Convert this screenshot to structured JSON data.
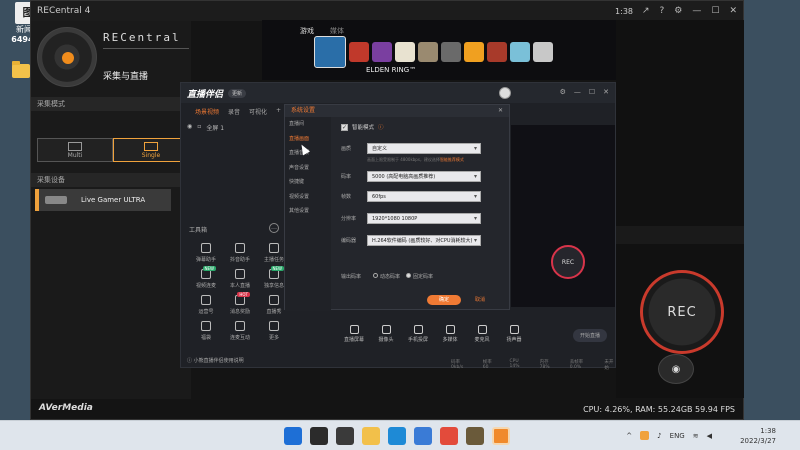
{
  "desktop": {
    "icon_label": "新闻号",
    "icon_number": "649457"
  },
  "recentral": {
    "title": "RECentral 4",
    "controls": [
      "↗",
      "?",
      "⚙",
      "—",
      "☐",
      "✕"
    ],
    "brand": "RECentral",
    "subtitle": "采集与直播",
    "mode_label": "采集模式",
    "modes": [
      {
        "label": "Multi"
      },
      {
        "label": "Single",
        "selected": true
      }
    ],
    "device_label": "采集设备",
    "device_name": "Live Gamer ULTRA",
    "vendor": "AVerMedia",
    "stats": "CPU: 4.26%, RAM: 55.24GB  59.94 FPS",
    "rec_label": "REC",
    "timer": "1:38"
  },
  "game": {
    "tabs": [
      "游戏",
      "媒体"
    ],
    "selected_game": "ELDEN RING™",
    "tile_colors": [
      "#2a6ea8",
      "#c0392b",
      "#7a3fa0",
      "#e8e2d0",
      "#9a8a70",
      "#6a6a6a",
      "#f0a020",
      "#a83a2a",
      "#7ac0d8",
      "#c8c8c8"
    ]
  },
  "streamer": {
    "logo": "直播伴侣",
    "badge": "更新",
    "window_controls": [
      "⚙",
      "—",
      "☐",
      "✕"
    ],
    "tabs": [
      {
        "label": "场景视频",
        "active": true
      },
      {
        "label": "录音"
      },
      {
        "label": "可视化"
      },
      {
        "label": "+"
      }
    ],
    "scene_item": "全屏 1",
    "tools_heading": "工具箱",
    "tools": [
      "弹幕助手",
      "抖音助手",
      "主播任务",
      "视频连麦",
      "本人直播",
      "独享信息",
      "运营号",
      "消息奖励",
      "直播秀",
      "福袋",
      "连麦互动",
      "更多"
    ],
    "tool_tags": {
      "视频连麦": "NEW",
      "独享信息": "NEW",
      "消息奖励": "HOT"
    },
    "footer": "小熊直播伴侣使用说明",
    "bottom_tools": [
      "直播屏幕",
      "摄像头",
      "手机投屏",
      "多媒体",
      "麦克风",
      "扬声器"
    ],
    "start_live": "开始直播",
    "stats_row": [
      "码率 0kb/s",
      "帧率 60",
      "CPU 14%",
      "内存 78%",
      "丢帧率 0.0%",
      "未开始"
    ]
  },
  "settings": {
    "header": "系统设置",
    "menu": [
      "直播间",
      "直播画面",
      "直播音频",
      "声音设置",
      "快捷键",
      "视频设置",
      "其他设置"
    ],
    "active_menu": 1,
    "smart_mode_label": "智能模式",
    "fields": [
      {
        "label": "画质",
        "value": "自定义"
      },
      {
        "label": "码率",
        "value": "5000 (高配电脑高画质推荐)"
      },
      {
        "label": "帧数",
        "value": "60fps"
      },
      {
        "label": "分辨率",
        "value": "1920*1080 1080P"
      },
      {
        "label": "编码器",
        "value": "H.264软件编码 (画质较好、对CPU消耗较大)"
      }
    ],
    "hint": "画面上限受限制于  4800kbps，建议选择",
    "hint_link": "智能推荐模式",
    "output_label": "输出码率",
    "output_options": [
      {
        "label": "动态码率",
        "on": false
      },
      {
        "label": "固定码率",
        "on": true
      }
    ],
    "ok": "确定",
    "cancel": "取消"
  },
  "taskbar": {
    "icons": [
      "windows-icon",
      "search-icon",
      "taskview-icon",
      "explorer-icon",
      "edge-icon",
      "store-icon",
      "chrome-icon",
      "game-icon",
      "app-icon"
    ],
    "tray": [
      "^",
      "ENG"
    ],
    "time": "1:38",
    "date": "2022/3/27"
  }
}
